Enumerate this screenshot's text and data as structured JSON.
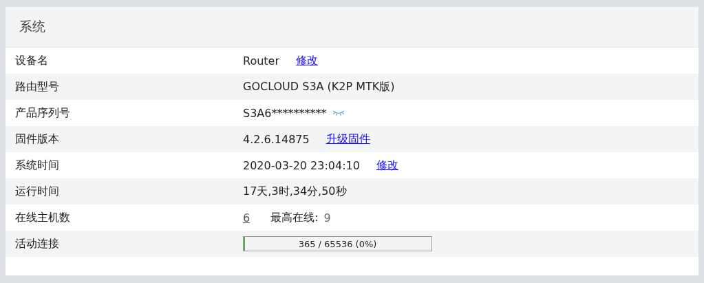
{
  "panel": {
    "title": "系统"
  },
  "rows": [
    {
      "kind": "link",
      "label": "设备名",
      "value": "Router",
      "link": "修改"
    },
    {
      "kind": "text",
      "label": "路由型号",
      "value": "GOCLOUD S3A (K2P MTK版)"
    },
    {
      "kind": "masked",
      "label": "产品序列号",
      "value": "S3A6**********"
    },
    {
      "kind": "link",
      "label": "固件版本",
      "value": "4.2.6.14875",
      "link": "升级固件"
    },
    {
      "kind": "link",
      "label": "系统时间",
      "value": "2020-03-20 23:04:10",
      "link": "修改"
    },
    {
      "kind": "text",
      "label": "运行时间",
      "value": "17天,3时,34分,50秒"
    },
    {
      "kind": "hosts",
      "label": "在线主机数",
      "value": "6",
      "peak_label": "最高在线:",
      "peak": "9"
    },
    {
      "kind": "meter",
      "label": "活动连接",
      "value": "365 / 65536 (0%)",
      "level": 0.0056
    }
  ]
}
